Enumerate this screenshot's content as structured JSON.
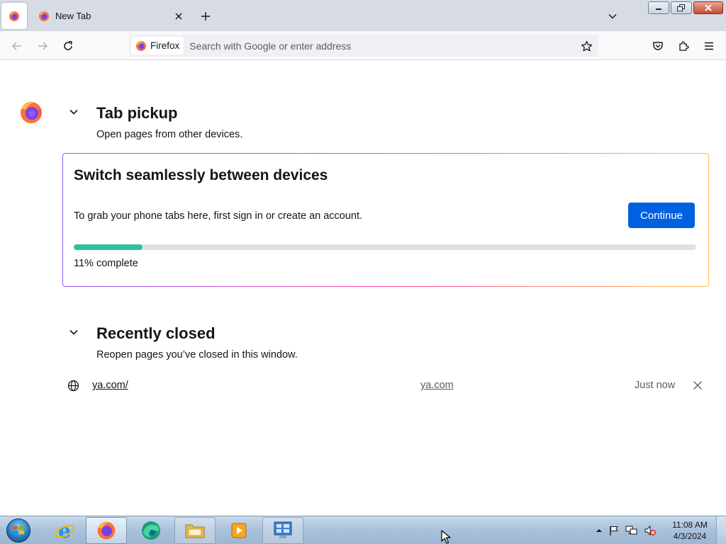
{
  "browser": {
    "tabs": [
      {
        "label": "New Tab"
      }
    ],
    "urlbar": {
      "identity_label": "Firefox",
      "placeholder": "Search with Google or enter address"
    }
  },
  "tab_pickup": {
    "title": "Tab pickup",
    "subtitle": "Open pages from other devices.",
    "card": {
      "title": "Switch seamlessly between devices",
      "text": "To grab your phone tabs here, first sign in or create an account.",
      "button_label": "Continue",
      "progress_percent": 11,
      "progress_label": "11% complete"
    }
  },
  "recently_closed": {
    "title": "Recently closed",
    "subtitle": "Reopen pages you’ve closed in this window.",
    "items": [
      {
        "title": "ya.com/",
        "url": "ya.com",
        "time": "Just now"
      }
    ]
  },
  "taskbar": {
    "items": [
      "internet-explorer",
      "firefox",
      "edge",
      "file-explorer",
      "media-player",
      "control-panel"
    ],
    "clock": {
      "time": "11:08 AM",
      "date": "4/3/2024"
    }
  },
  "colors": {
    "accent": "#0061e0",
    "progress": "#2ac3a2",
    "tabbar": "#d7dbe3"
  }
}
